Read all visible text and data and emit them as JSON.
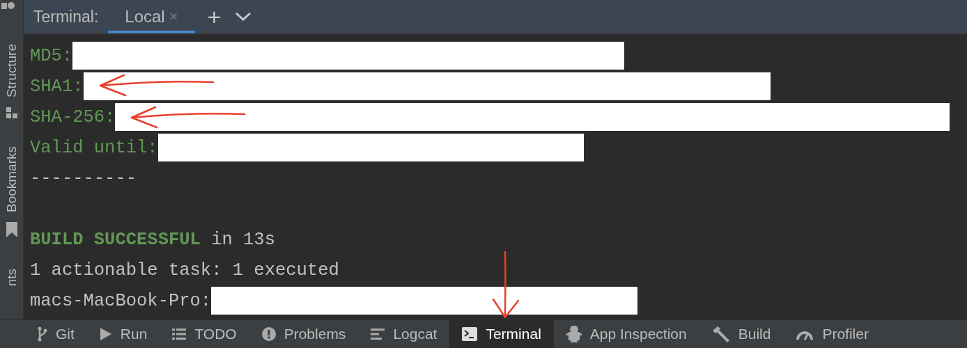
{
  "left_strip": [
    {
      "label": "Structure",
      "kind": "structure"
    },
    {
      "label": "Bookmarks",
      "kind": "bookmark"
    },
    {
      "label": "nts",
      "kind": "none"
    }
  ],
  "terminal": {
    "title": "Terminal:",
    "tabs": [
      {
        "label": "Local",
        "selected": true,
        "close": "×"
      }
    ],
    "add": "+"
  },
  "lines": [
    {
      "kind": "field",
      "text": "MD5:",
      "redacted": true,
      "annotated": false
    },
    {
      "kind": "field",
      "text": "SHA1:",
      "redacted": true,
      "annotated": true
    },
    {
      "kind": "field",
      "text": "SHA-256:",
      "redacted": true,
      "annotated": true
    },
    {
      "kind": "field",
      "text": "Valid until:",
      "redacted": true,
      "annotated": false
    },
    {
      "kind": "plain",
      "text": "----------"
    },
    {
      "kind": "blank"
    },
    {
      "kind": "build",
      "status": "BUILD SUCCESSFUL",
      "rest": " in 13s"
    },
    {
      "kind": "plain",
      "text": "1 actionable task: 1 executed"
    },
    {
      "kind": "prompt",
      "text": "macs-MacBook-Pro:",
      "redacted": true,
      "annotated": false
    }
  ],
  "bottom_tabs": [
    {
      "label": "Git",
      "kind": "git",
      "selected": false,
      "annotated": false
    },
    {
      "label": "Run",
      "kind": "run",
      "selected": false,
      "annotated": false
    },
    {
      "label": "TODO",
      "kind": "todo",
      "selected": false,
      "annotated": false
    },
    {
      "label": "Problems",
      "kind": "problems",
      "selected": false,
      "annotated": false
    },
    {
      "label": "Logcat",
      "kind": "logcat",
      "selected": false,
      "annotated": false
    },
    {
      "label": "Terminal",
      "kind": "terminal",
      "selected": true,
      "annotated": true
    },
    {
      "label": "App Inspection",
      "kind": "inspection",
      "selected": false,
      "annotated": false
    },
    {
      "label": "Build",
      "kind": "build",
      "selected": false,
      "annotated": false
    },
    {
      "label": "Profiler",
      "kind": "profiler",
      "selected": false,
      "annotated": false
    }
  ]
}
